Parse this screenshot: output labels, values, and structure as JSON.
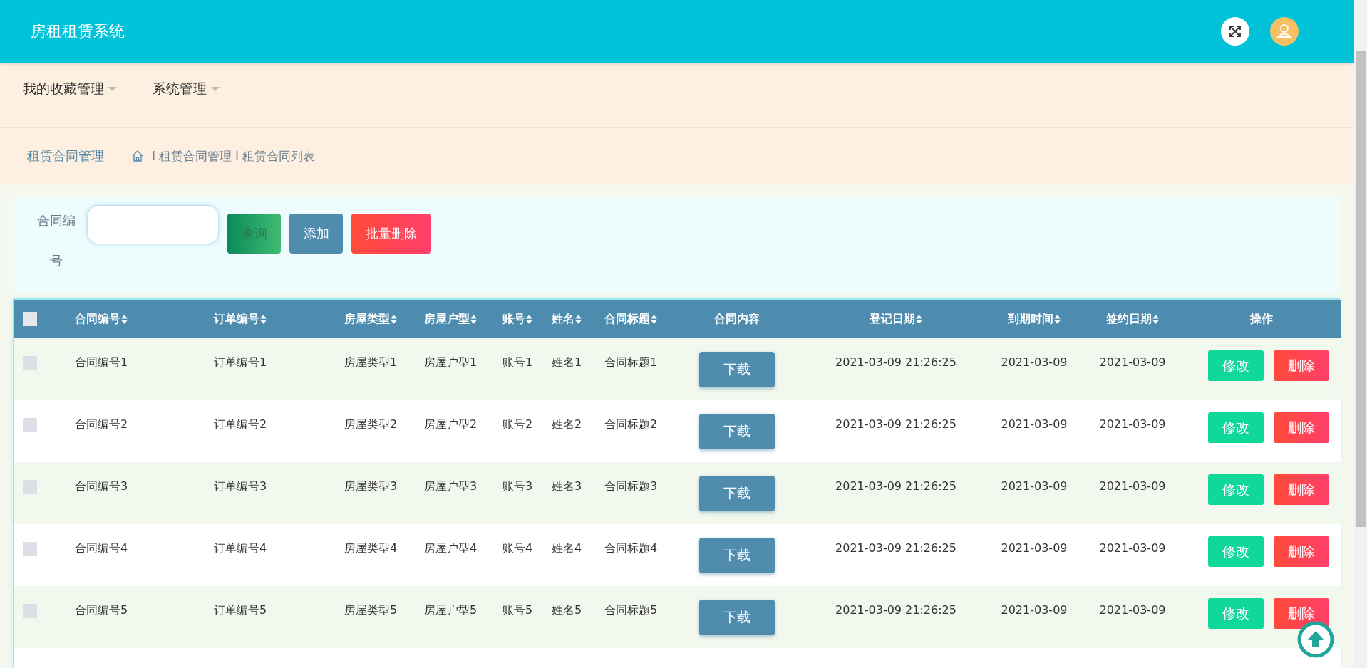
{
  "header": {
    "title": "房租租赁系统"
  },
  "nav": {
    "items": [
      {
        "label": "我的收藏管理"
      },
      {
        "label": "系统管理"
      }
    ]
  },
  "breadcrumb": {
    "title": "租赁合同管理",
    "path": [
      {
        "separator": "I",
        "label": "租赁合同管理"
      },
      {
        "separator": "I",
        "label": "租赁合同列表"
      }
    ]
  },
  "search": {
    "label": "合同编号",
    "buttons": [
      {
        "label": "查询",
        "kind": "search"
      },
      {
        "label": "添加",
        "kind": "add"
      },
      {
        "label": "批量删除",
        "kind": "delete"
      }
    ]
  },
  "table": {
    "select_all": {
      "checked": false
    },
    "columns": [
      {
        "label": "合同编号",
        "sortable": true
      },
      {
        "label": "订单编号",
        "sortable": true
      },
      {
        "label": "房屋类型",
        "sortable": true
      },
      {
        "label": "房屋户型",
        "sortable": true
      },
      {
        "label": "账号",
        "sortable": true
      },
      {
        "label": "姓名",
        "sortable": true
      },
      {
        "label": "合同标题",
        "sortable": true
      },
      {
        "label": "合同内容",
        "sortable": false
      },
      {
        "label": "登记日期",
        "sortable": true
      },
      {
        "label": "到期时间",
        "sortable": true
      },
      {
        "label": "签约日期",
        "sortable": true
      },
      {
        "label": "操作",
        "sortable": false
      }
    ],
    "rows": [
      {
        "checked": false,
        "cells": [
          "合同编号1",
          "订单编号1",
          "房屋类型1",
          "房屋户型1",
          "账号1",
          "姓名1",
          "合同标题1"
        ],
        "download": "下载",
        "dates": [
          "2021-03-09 21:26:25",
          "2021-03-09",
          "2021-03-09"
        ],
        "actions": [
          "修改",
          "删除"
        ]
      },
      {
        "checked": false,
        "cells": [
          "合同编号2",
          "订单编号2",
          "房屋类型2",
          "房屋户型2",
          "账号2",
          "姓名2",
          "合同标题2"
        ],
        "download": "下载",
        "dates": [
          "2021-03-09 21:26:25",
          "2021-03-09",
          "2021-03-09"
        ],
        "actions": [
          "修改",
          "删除"
        ]
      },
      {
        "checked": false,
        "cells": [
          "合同编号3",
          "订单编号3",
          "房屋类型3",
          "房屋户型3",
          "账号3",
          "姓名3",
          "合同标题3"
        ],
        "download": "下载",
        "dates": [
          "2021-03-09 21:26:25",
          "2021-03-09",
          "2021-03-09"
        ],
        "actions": [
          "修改",
          "删除"
        ]
      },
      {
        "checked": false,
        "cells": [
          "合同编号4",
          "订单编号4",
          "房屋类型4",
          "房屋户型4",
          "账号4",
          "姓名4",
          "合同标题4"
        ],
        "download": "下载",
        "dates": [
          "2021-03-09 21:26:25",
          "2021-03-09",
          "2021-03-09"
        ],
        "actions": [
          "修改",
          "删除"
        ]
      },
      {
        "checked": false,
        "cells": [
          "合同编号5",
          "订单编号5",
          "房屋类型5",
          "房屋户型5",
          "账号5",
          "姓名5",
          "合同标题5"
        ],
        "download": "下载",
        "dates": [
          "2021-03-09 21:26:25",
          "2021-03-09",
          "2021-03-09"
        ],
        "actions": [
          "修改",
          "删除"
        ]
      }
    ]
  }
}
